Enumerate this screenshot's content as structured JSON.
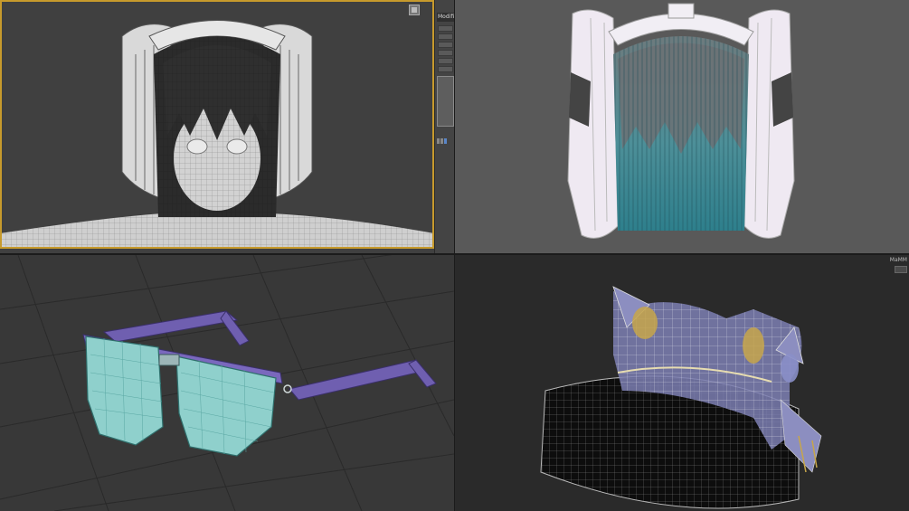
{
  "panel": {
    "tab_label": "Modifier L"
  },
  "viewport_bottom_right": {
    "tag": "MaMM"
  },
  "colors": {
    "active_viewport_border": "#c79a2c",
    "hair_teal": "#3a9aa6",
    "glasses_lens": "#8fd0cc",
    "glasses_frame": "#6f5fb0",
    "hat_fabric": "#7d7fb3",
    "hat_gold": "#c7a64a"
  },
  "icons": [
    "viewport-maximize-icon",
    "modifier-list-icon"
  ]
}
